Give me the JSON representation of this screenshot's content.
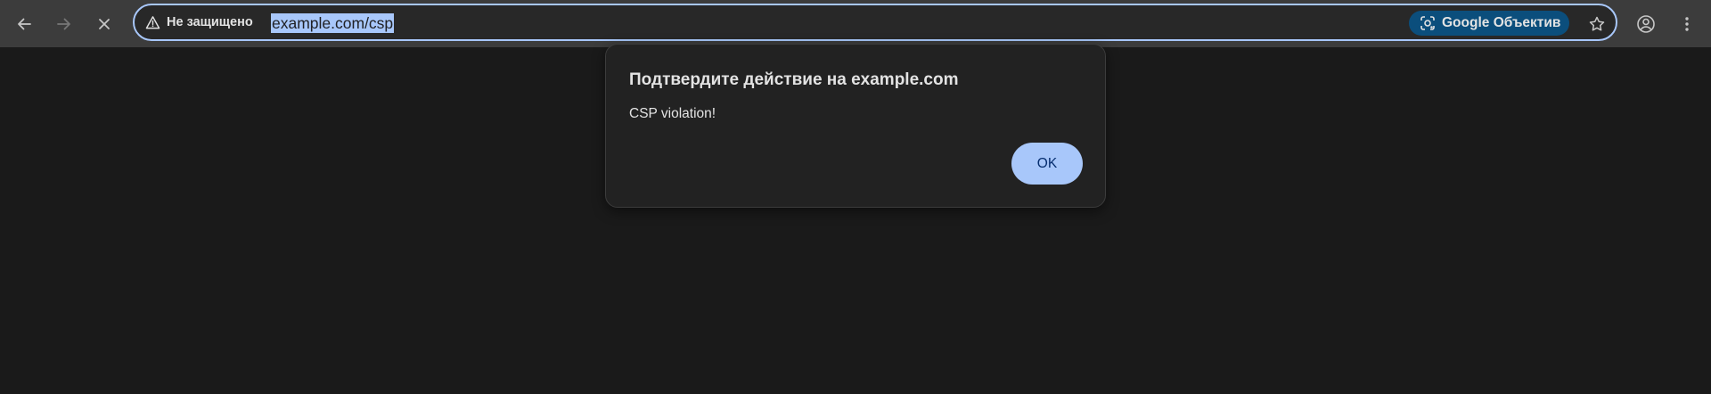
{
  "toolbar": {
    "back_icon": "arrow-left-icon",
    "forward_icon": "arrow-right-icon",
    "stop_icon": "close-icon"
  },
  "omnibox": {
    "security_icon": "warning-triangle-icon",
    "security_label": "Не защищено",
    "url": "example.com/csp",
    "lens_label": "Google Объектив",
    "lens_icon": "lens-icon",
    "bookmark_icon": "star-icon",
    "focus_color": "#a8c7fa"
  },
  "profile_icon": "account-circle-icon",
  "menu_icon": "more-vertical-icon",
  "dialog": {
    "title": "Подтвердите действие на example.com",
    "message": "CSP violation!",
    "ok_label": "OK",
    "accent": "#a8c7fa"
  }
}
